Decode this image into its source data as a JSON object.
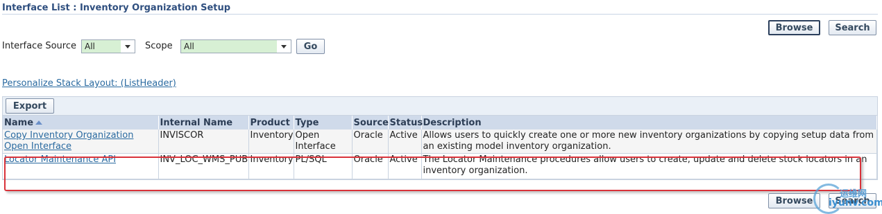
{
  "header": {
    "title": "Interface List : Inventory Organization Setup"
  },
  "top_buttons": {
    "browse_label": "Browse",
    "search_label": "Search"
  },
  "filters": {
    "source_label": "Interface Source",
    "source_value": "All",
    "scope_label": "Scope",
    "scope_value": "All",
    "go_label": "Go"
  },
  "personalize_link": "Personalize Stack Layout: (ListHeader)",
  "table": {
    "export_label": "Export",
    "columns": [
      "Name",
      "Internal Name",
      "Product",
      "Type",
      "Source",
      "Status",
      "Description"
    ],
    "rows": [
      {
        "name": "Copy Inventory Organization Open Interface",
        "internal_name": "INVISCOR",
        "product": "Inventory",
        "type": "Open Interface",
        "source": "Oracle",
        "status": "Active",
        "description": "Allows users to quickly create one or more new inventory organizations by copying setup data from an existing model inventory organization."
      },
      {
        "name": "Locator Maintenance API",
        "internal_name": "INV_LOC_WMS_PUB",
        "product": "Inventory",
        "type": "PL/SQL",
        "source": "Oracle",
        "status": "Active",
        "description": "The Locator Maintenance procedures allow users to create, update and delete stock locators in an inventory organization."
      }
    ]
  },
  "bottom_buttons": {
    "browse_label": "Browse",
    "search_label": "Search"
  },
  "watermark": {
    "line1": "运维网",
    "line2": "iyunv.com"
  },
  "colors": {
    "accent": "#2f4f7f",
    "link": "#2a6aa0",
    "highlight": "#d9323a",
    "select_bg": "#d7f0d4"
  }
}
